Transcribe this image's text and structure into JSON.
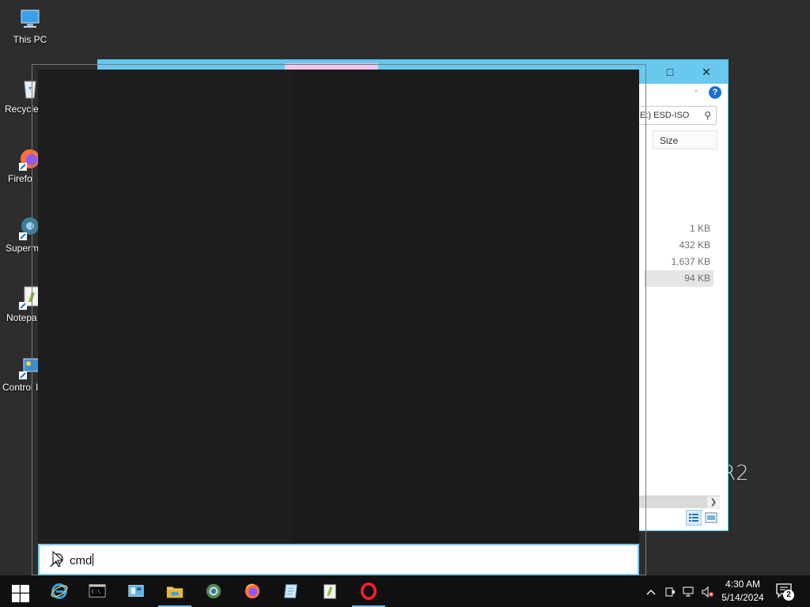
{
  "desktop": {
    "icons": [
      {
        "label": "This PC",
        "icon": "this-pc-icon"
      },
      {
        "label": "Recycle",
        "icon": "recycle-bin-icon"
      },
      {
        "label": "Firefo",
        "icon": "firefox-icon"
      },
      {
        "label": "Superm",
        "icon": "supermium-icon"
      },
      {
        "label": "Notepa",
        "icon": "notepad-icon"
      },
      {
        "label": "Control I",
        "icon": "control-panel-icon"
      }
    ],
    "brand_fragment": "R2"
  },
  "explorer": {
    "search_text": "E:) ESD-ISO",
    "column_header": "Size",
    "sizes": [
      "1 KB",
      "432 KB",
      "1,637 KB",
      "94 KB"
    ],
    "selected_row": 3,
    "help_glyph": "?",
    "maximize_glyph": "□",
    "close_glyph": "✕"
  },
  "start_search": {
    "query": "cmd"
  },
  "taskbar": {
    "apps": [
      {
        "name": "internet-explorer",
        "active": false
      },
      {
        "name": "command-prompt",
        "active": false
      },
      {
        "name": "server-manager",
        "active": false
      },
      {
        "name": "file-explorer",
        "active": true
      },
      {
        "name": "supermium",
        "active": false
      },
      {
        "name": "firefox",
        "active": false
      },
      {
        "name": "notepad",
        "active": false
      },
      {
        "name": "notepad-plus",
        "active": false
      },
      {
        "name": "opera",
        "active": true
      }
    ],
    "tray": {
      "chevron": "^",
      "time": "4:30 AM",
      "date": "5/14/2024",
      "notification_count": "2"
    }
  },
  "colors": {
    "desktop": "#2d2d2d",
    "taskbar": "#101010",
    "accent": "#76b9ed",
    "explorer_title": "#69c8ee",
    "search_panel": "#1b1b1b"
  }
}
